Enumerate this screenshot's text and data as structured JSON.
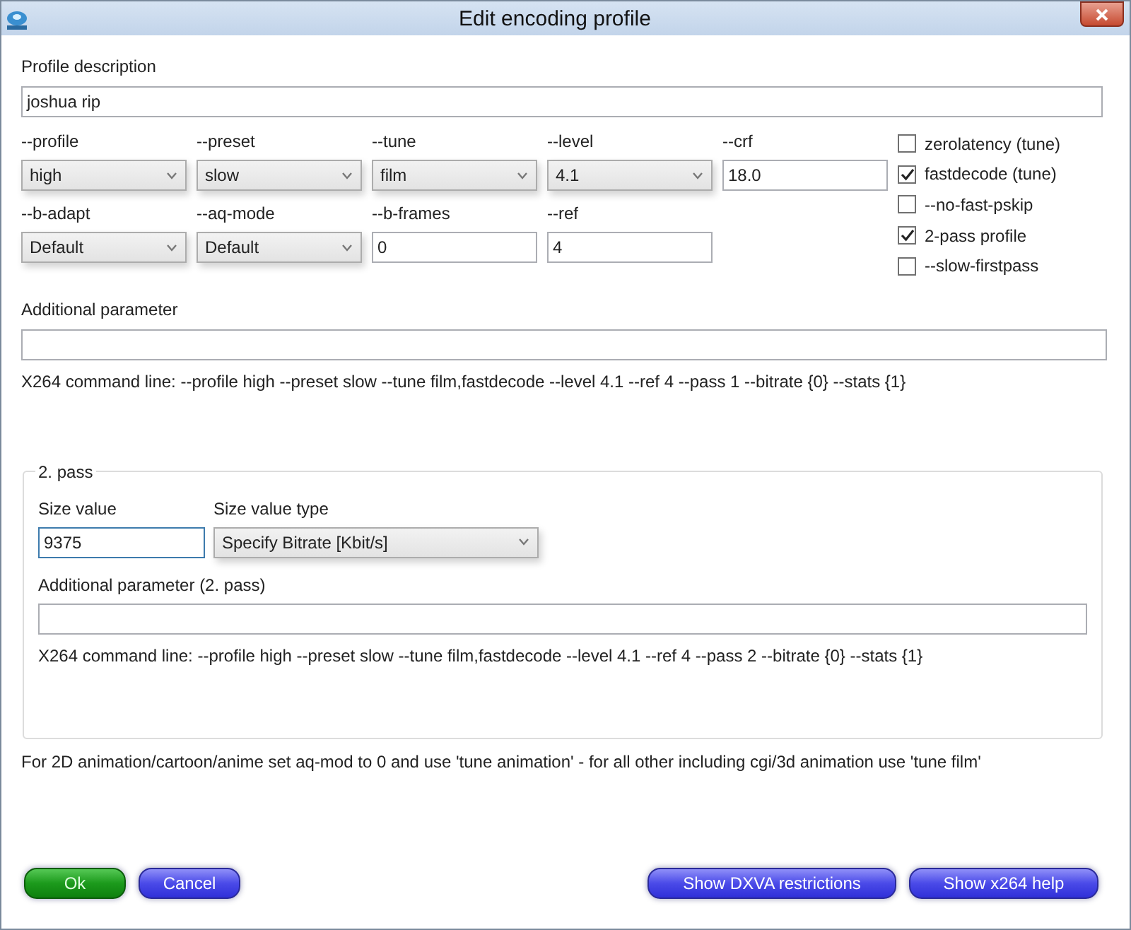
{
  "window": {
    "title": "Edit encoding profile"
  },
  "profile_description": {
    "label": "Profile description",
    "value": "joshua rip"
  },
  "field_rows": [
    [
      {
        "label": "--profile",
        "kind": "select",
        "value": "high"
      },
      {
        "label": "--preset",
        "kind": "select",
        "value": "slow"
      },
      {
        "label": "--tune",
        "kind": "select",
        "value": "film"
      },
      {
        "label": "--level",
        "kind": "select",
        "value": "4.1"
      },
      {
        "label": "--crf",
        "kind": "input",
        "value": "18.0"
      }
    ],
    [
      {
        "label": "--b-adapt",
        "kind": "select",
        "value": "Default"
      },
      {
        "label": "--aq-mode",
        "kind": "select",
        "value": "Default"
      },
      {
        "label": "--b-frames",
        "kind": "input",
        "value": "0"
      },
      {
        "label": "--ref",
        "kind": "input",
        "value": "4"
      }
    ]
  ],
  "checkboxes": [
    {
      "label": "zerolatency (tune)",
      "checked": false
    },
    {
      "label": "fastdecode (tune)",
      "checked": true
    },
    {
      "label": "--no-fast-pskip",
      "checked": false
    },
    {
      "label": "2-pass profile",
      "checked": true
    },
    {
      "label": "--slow-firstpass",
      "checked": false
    }
  ],
  "additional_parameter": {
    "label": "Additional parameter"
  },
  "command_line": "X264 command line: --profile high --preset slow --tune film,fastdecode --level 4.1 --ref 4 --pass 1 --bitrate {0} --stats {1}",
  "second_pass": {
    "title": "2. pass",
    "size_value": {
      "label": "Size value",
      "value": "9375",
      "focused": true
    },
    "size_value_type": {
      "label": "Size value type",
      "value": "Specify Bitrate [Kbit/s]"
    },
    "additional_parameter": {
      "label": "Additional parameter (2. pass)"
    },
    "command_line": "X264 command line: --profile high --preset slow --tune film,fastdecode --level 4.1 --ref 4 --pass 2 --bitrate {0} --stats {1}"
  },
  "note": "For 2D animation/cartoon/anime set aq-mod to 0 and use 'tune animation' - for all other including cgi/3d animation use 'tune film'",
  "buttons_left": [
    {
      "label": "Ok",
      "kind": "default"
    },
    {
      "label": "Cancel",
      "kind": "normal"
    }
  ],
  "buttons_right": [
    {
      "label": "Show DXVA restrictions",
      "kind": "normal"
    },
    {
      "label": "Show x264 help",
      "kind": "normal"
    }
  ]
}
